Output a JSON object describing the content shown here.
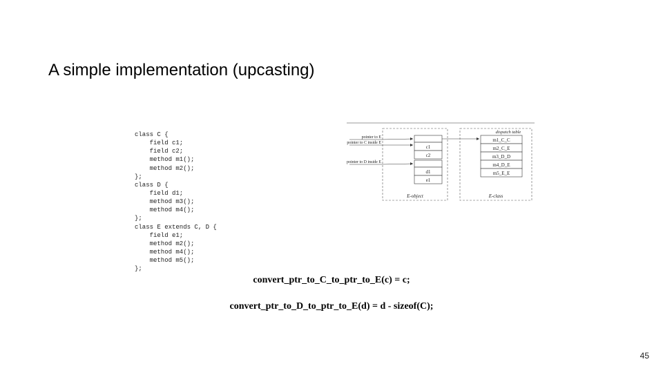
{
  "title": "A simple implementation (upcasting)",
  "code": "class C {\n    field c1;\n    field c2;\n    method m1();\n    method m2();\n};\nclass D {\n    field d1;\n    method m3();\n    method m4();\n};\nclass E extends C, D {\n    field e1;\n    method m2();\n    method m4();\n    method m5();\n};",
  "diagram": {
    "captions": {
      "obj": "E-object",
      "cls": "E-class"
    },
    "ptrLabels": {
      "toE": "pointer to E",
      "toCinE": "pointer to C inside E",
      "toDinE": "pointer to D inside E"
    },
    "objCells": [
      "c1",
      "c2",
      "d1",
      "e1"
    ],
    "dispatchHeader": "dispatch table",
    "dispatch": [
      "m1_C_C",
      "m2_C_E",
      "m3_D_D",
      "m4_D_E",
      "m5_E_E"
    ]
  },
  "formulas": {
    "line1": "convert_ptr_to_C_to_ptr_to_E(c) = c;",
    "line2": "convert_ptr_to_D_to_ptr_to_E(d) = d - sizeof(C);"
  },
  "pageNumber": "45"
}
